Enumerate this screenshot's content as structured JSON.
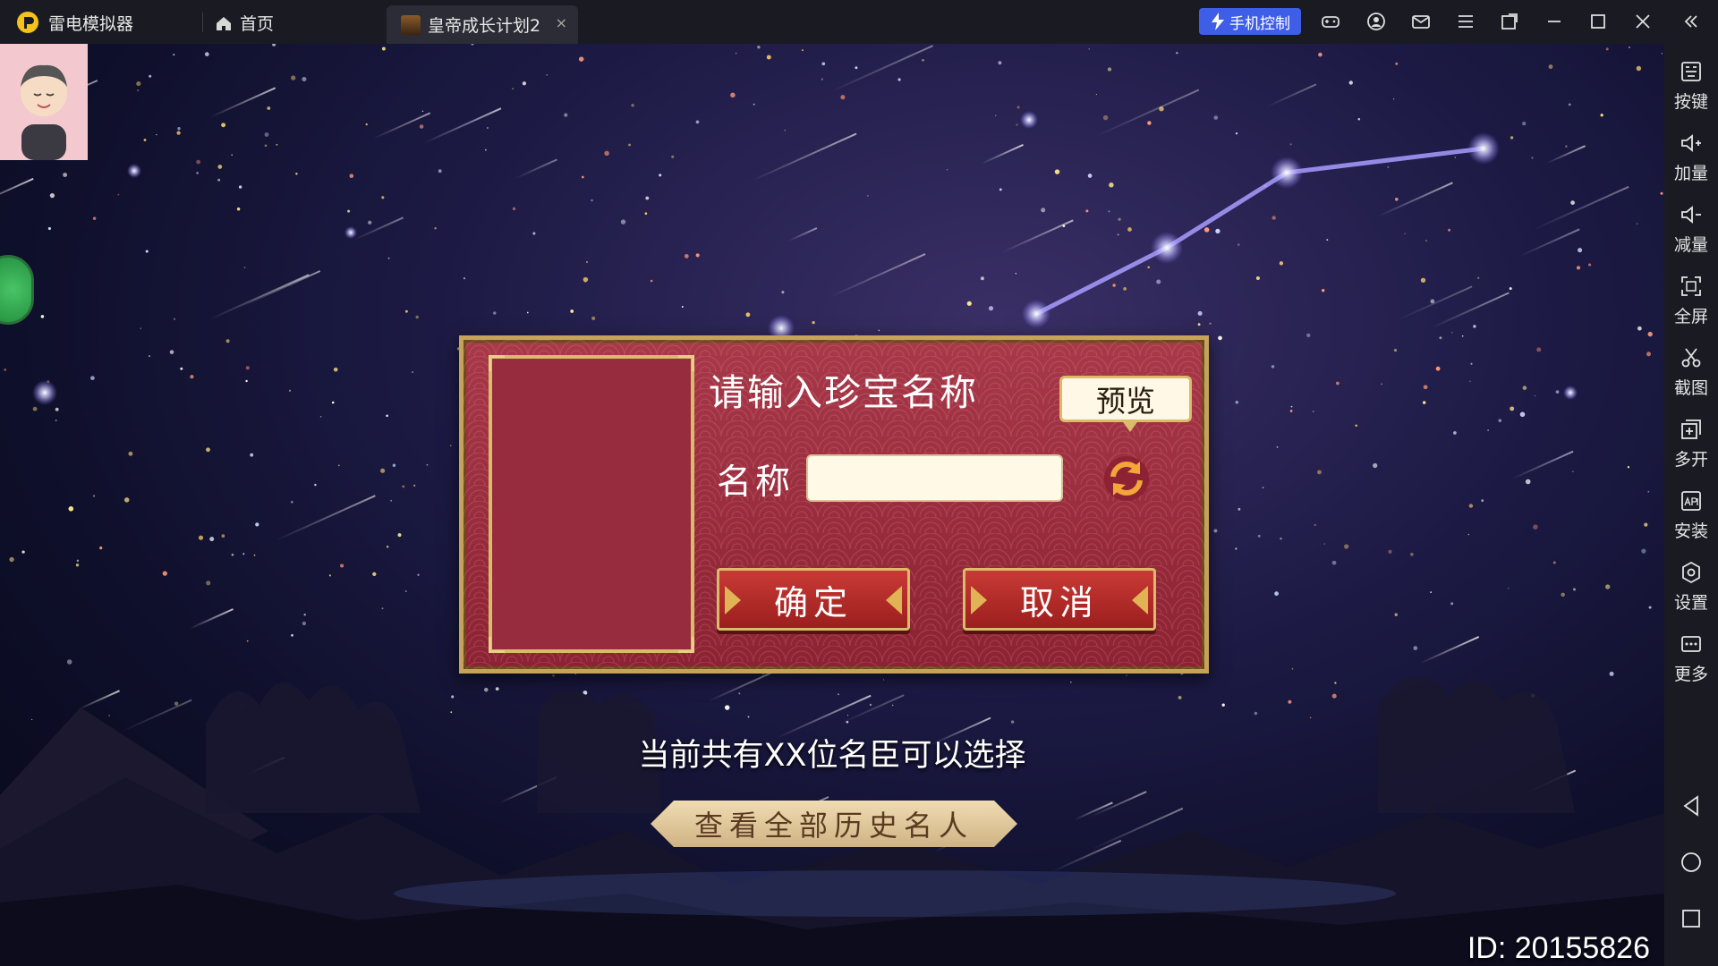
{
  "titlebar": {
    "app_name": "雷电模拟器",
    "home_tab": "首页",
    "game_tab": "皇帝成长计划2",
    "tab_close": "×",
    "phone_control": "手机控制"
  },
  "sidebar": {
    "items": [
      {
        "label": "按键",
        "icon": "keyboard-icon"
      },
      {
        "label": "加量",
        "icon": "volume-up-icon"
      },
      {
        "label": "减量",
        "icon": "volume-down-icon"
      },
      {
        "label": "全屏",
        "icon": "fullscreen-icon"
      },
      {
        "label": "截图",
        "icon": "scissors-icon"
      },
      {
        "label": "多开",
        "icon": "multi-instance-icon"
      },
      {
        "label": "安装",
        "icon": "apk-icon"
      },
      {
        "label": "设置",
        "icon": "gear-icon"
      },
      {
        "label": "更多",
        "icon": "more-icon"
      }
    ]
  },
  "dialog": {
    "title": "请输入珍宝名称",
    "preview": "预览",
    "name_label": "名称",
    "name_value": "",
    "confirm": "确定",
    "cancel": "取消"
  },
  "game": {
    "status_text": "当前共有XX位名臣可以选择",
    "history_button": "查看全部历史名人",
    "id_text": "ID: 20155826"
  },
  "colors": {
    "titlebar_bg": "#1a1b22",
    "accent_blue": "#3f5ee8",
    "dialog_red": "#9b2a3a",
    "gold": "#d9bb6a"
  }
}
